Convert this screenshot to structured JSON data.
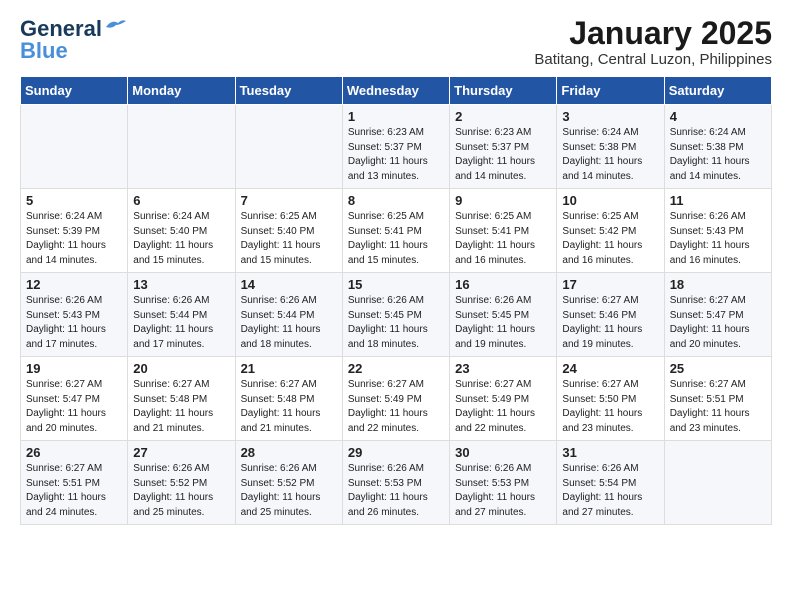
{
  "header": {
    "logo_line1": "General",
    "logo_line2": "Blue",
    "title": "January 2025",
    "subtitle": "Batitang, Central Luzon, Philippines"
  },
  "weekdays": [
    "Sunday",
    "Monday",
    "Tuesday",
    "Wednesday",
    "Thursday",
    "Friday",
    "Saturday"
  ],
  "weeks": [
    [
      {
        "day": "",
        "sunrise": "",
        "sunset": "",
        "daylight": ""
      },
      {
        "day": "",
        "sunrise": "",
        "sunset": "",
        "daylight": ""
      },
      {
        "day": "",
        "sunrise": "",
        "sunset": "",
        "daylight": ""
      },
      {
        "day": "1",
        "sunrise": "Sunrise: 6:23 AM",
        "sunset": "Sunset: 5:37 PM",
        "daylight": "Daylight: 11 hours and 13 minutes."
      },
      {
        "day": "2",
        "sunrise": "Sunrise: 6:23 AM",
        "sunset": "Sunset: 5:37 PM",
        "daylight": "Daylight: 11 hours and 14 minutes."
      },
      {
        "day": "3",
        "sunrise": "Sunrise: 6:24 AM",
        "sunset": "Sunset: 5:38 PM",
        "daylight": "Daylight: 11 hours and 14 minutes."
      },
      {
        "day": "4",
        "sunrise": "Sunrise: 6:24 AM",
        "sunset": "Sunset: 5:38 PM",
        "daylight": "Daylight: 11 hours and 14 minutes."
      }
    ],
    [
      {
        "day": "5",
        "sunrise": "Sunrise: 6:24 AM",
        "sunset": "Sunset: 5:39 PM",
        "daylight": "Daylight: 11 hours and 14 minutes."
      },
      {
        "day": "6",
        "sunrise": "Sunrise: 6:24 AM",
        "sunset": "Sunset: 5:40 PM",
        "daylight": "Daylight: 11 hours and 15 minutes."
      },
      {
        "day": "7",
        "sunrise": "Sunrise: 6:25 AM",
        "sunset": "Sunset: 5:40 PM",
        "daylight": "Daylight: 11 hours and 15 minutes."
      },
      {
        "day": "8",
        "sunrise": "Sunrise: 6:25 AM",
        "sunset": "Sunset: 5:41 PM",
        "daylight": "Daylight: 11 hours and 15 minutes."
      },
      {
        "day": "9",
        "sunrise": "Sunrise: 6:25 AM",
        "sunset": "Sunset: 5:41 PM",
        "daylight": "Daylight: 11 hours and 16 minutes."
      },
      {
        "day": "10",
        "sunrise": "Sunrise: 6:25 AM",
        "sunset": "Sunset: 5:42 PM",
        "daylight": "Daylight: 11 hours and 16 minutes."
      },
      {
        "day": "11",
        "sunrise": "Sunrise: 6:26 AM",
        "sunset": "Sunset: 5:43 PM",
        "daylight": "Daylight: 11 hours and 16 minutes."
      }
    ],
    [
      {
        "day": "12",
        "sunrise": "Sunrise: 6:26 AM",
        "sunset": "Sunset: 5:43 PM",
        "daylight": "Daylight: 11 hours and 17 minutes."
      },
      {
        "day": "13",
        "sunrise": "Sunrise: 6:26 AM",
        "sunset": "Sunset: 5:44 PM",
        "daylight": "Daylight: 11 hours and 17 minutes."
      },
      {
        "day": "14",
        "sunrise": "Sunrise: 6:26 AM",
        "sunset": "Sunset: 5:44 PM",
        "daylight": "Daylight: 11 hours and 18 minutes."
      },
      {
        "day": "15",
        "sunrise": "Sunrise: 6:26 AM",
        "sunset": "Sunset: 5:45 PM",
        "daylight": "Daylight: 11 hours and 18 minutes."
      },
      {
        "day": "16",
        "sunrise": "Sunrise: 6:26 AM",
        "sunset": "Sunset: 5:45 PM",
        "daylight": "Daylight: 11 hours and 19 minutes."
      },
      {
        "day": "17",
        "sunrise": "Sunrise: 6:27 AM",
        "sunset": "Sunset: 5:46 PM",
        "daylight": "Daylight: 11 hours and 19 minutes."
      },
      {
        "day": "18",
        "sunrise": "Sunrise: 6:27 AM",
        "sunset": "Sunset: 5:47 PM",
        "daylight": "Daylight: 11 hours and 20 minutes."
      }
    ],
    [
      {
        "day": "19",
        "sunrise": "Sunrise: 6:27 AM",
        "sunset": "Sunset: 5:47 PM",
        "daylight": "Daylight: 11 hours and 20 minutes."
      },
      {
        "day": "20",
        "sunrise": "Sunrise: 6:27 AM",
        "sunset": "Sunset: 5:48 PM",
        "daylight": "Daylight: 11 hours and 21 minutes."
      },
      {
        "day": "21",
        "sunrise": "Sunrise: 6:27 AM",
        "sunset": "Sunset: 5:48 PM",
        "daylight": "Daylight: 11 hours and 21 minutes."
      },
      {
        "day": "22",
        "sunrise": "Sunrise: 6:27 AM",
        "sunset": "Sunset: 5:49 PM",
        "daylight": "Daylight: 11 hours and 22 minutes."
      },
      {
        "day": "23",
        "sunrise": "Sunrise: 6:27 AM",
        "sunset": "Sunset: 5:49 PM",
        "daylight": "Daylight: 11 hours and 22 minutes."
      },
      {
        "day": "24",
        "sunrise": "Sunrise: 6:27 AM",
        "sunset": "Sunset: 5:50 PM",
        "daylight": "Daylight: 11 hours and 23 minutes."
      },
      {
        "day": "25",
        "sunrise": "Sunrise: 6:27 AM",
        "sunset": "Sunset: 5:51 PM",
        "daylight": "Daylight: 11 hours and 23 minutes."
      }
    ],
    [
      {
        "day": "26",
        "sunrise": "Sunrise: 6:27 AM",
        "sunset": "Sunset: 5:51 PM",
        "daylight": "Daylight: 11 hours and 24 minutes."
      },
      {
        "day": "27",
        "sunrise": "Sunrise: 6:26 AM",
        "sunset": "Sunset: 5:52 PM",
        "daylight": "Daylight: 11 hours and 25 minutes."
      },
      {
        "day": "28",
        "sunrise": "Sunrise: 6:26 AM",
        "sunset": "Sunset: 5:52 PM",
        "daylight": "Daylight: 11 hours and 25 minutes."
      },
      {
        "day": "29",
        "sunrise": "Sunrise: 6:26 AM",
        "sunset": "Sunset: 5:53 PM",
        "daylight": "Daylight: 11 hours and 26 minutes."
      },
      {
        "day": "30",
        "sunrise": "Sunrise: 6:26 AM",
        "sunset": "Sunset: 5:53 PM",
        "daylight": "Daylight: 11 hours and 27 minutes."
      },
      {
        "day": "31",
        "sunrise": "Sunrise: 6:26 AM",
        "sunset": "Sunset: 5:54 PM",
        "daylight": "Daylight: 11 hours and 27 minutes."
      },
      {
        "day": "",
        "sunrise": "",
        "sunset": "",
        "daylight": ""
      }
    ]
  ]
}
